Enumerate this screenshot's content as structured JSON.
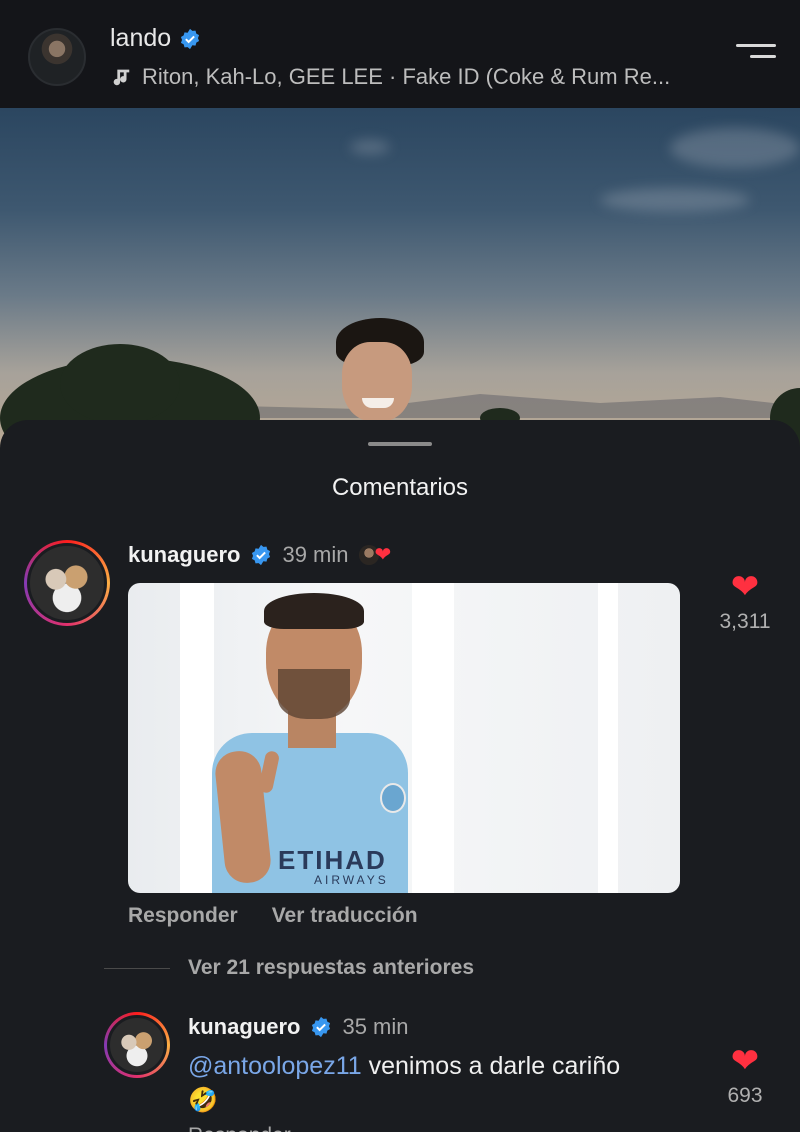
{
  "header": {
    "username": "lando",
    "music": "Riton, Kah-Lo, GEE LEE · Fake ID (Coke & Rum Re..."
  },
  "sheet": {
    "title": "Comentarios"
  },
  "comment": {
    "user": "kunaguero",
    "time": "39 min",
    "gif_text_1": "ETIHAD",
    "gif_text_2": "AIRWAYS",
    "actions": {
      "reply": "Responder",
      "translate": "Ver traducción"
    },
    "likes": "3,311"
  },
  "replies": {
    "link": "Ver 21 respuestas anteriores"
  },
  "reply": {
    "user": "kunaguero",
    "time": "35 min",
    "mention": "@antoolopez11",
    "text": " venimos a darle cariño",
    "emoji": "🤣",
    "likes": "693",
    "cut_action": "Responder"
  },
  "colors": {
    "like_red": "#ff3040",
    "mention_blue": "#7aa7e8",
    "verified_blue": "#3897f0"
  }
}
